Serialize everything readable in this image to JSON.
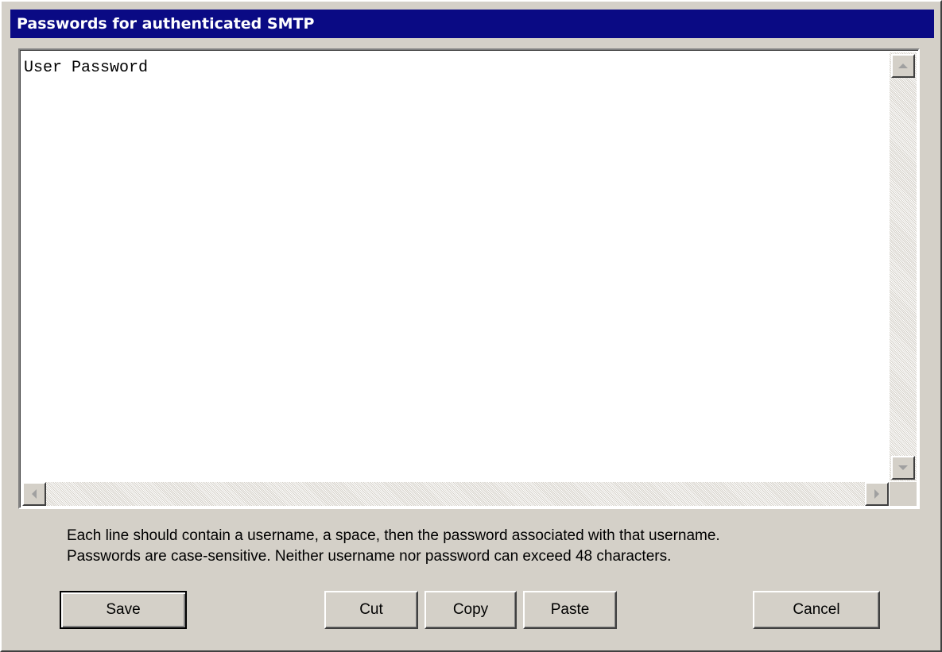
{
  "window": {
    "title": "Passwords for authenticated SMTP"
  },
  "editor": {
    "content": "User Password"
  },
  "help": {
    "line1": "Each line should contain a username, a space, then the password associated with that username.",
    "line2": "Passwords are case-sensitive. Neither username nor password can exceed 48 characters."
  },
  "buttons": {
    "save": "Save",
    "cut": "Cut",
    "copy": "Copy",
    "paste": "Paste",
    "cancel": "Cancel"
  },
  "icons": {
    "scroll_up": "scroll-up-arrow",
    "scroll_down": "scroll-down-arrow",
    "scroll_left": "scroll-left-arrow",
    "scroll_right": "scroll-right-arrow"
  },
  "colors": {
    "title_bar": "#0a0a84",
    "dialog_face": "#d4d0c8",
    "editor_background": "#ffffff"
  }
}
